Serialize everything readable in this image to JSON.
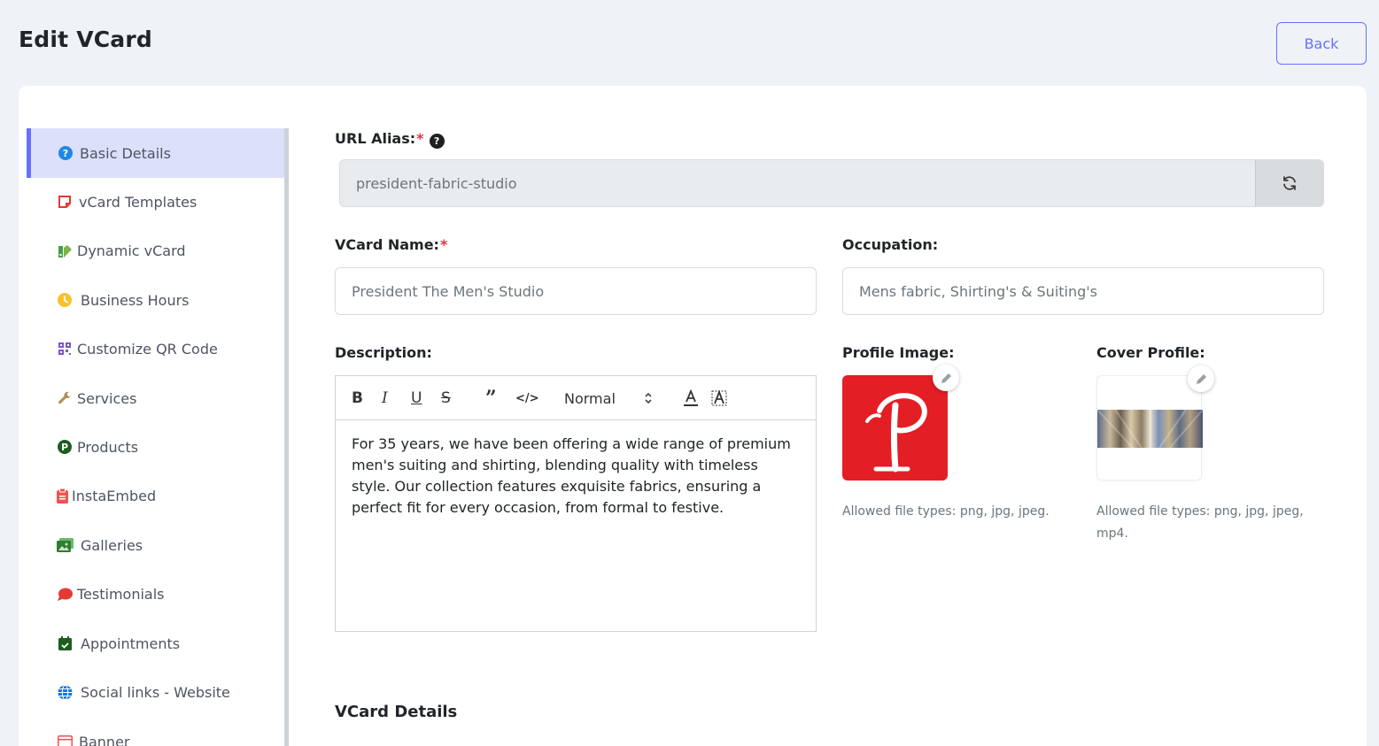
{
  "header": {
    "title": "Edit VCard",
    "back_label": "Back"
  },
  "sidebar": {
    "items": [
      {
        "label": "Basic Details",
        "icon": "question-circle-icon",
        "active": true
      },
      {
        "label": "vCard Templates",
        "icon": "template-icon"
      },
      {
        "label": "Dynamic vCard",
        "icon": "dynamic-palette-icon"
      },
      {
        "label": "Business Hours",
        "icon": "clock-icon"
      },
      {
        "label": "Customize QR Code",
        "icon": "qr-code-icon"
      },
      {
        "label": "Services",
        "icon": "wrench-icon"
      },
      {
        "label": "Products",
        "icon": "product-p-icon"
      },
      {
        "label": "InstaEmbed",
        "icon": "clipboard-icon"
      },
      {
        "label": "Galleries",
        "icon": "image-icon"
      },
      {
        "label": "Testimonials",
        "icon": "comment-icon"
      },
      {
        "label": "Appointments",
        "icon": "calendar-check-icon"
      },
      {
        "label": "Social links - Website",
        "icon": "globe-icon"
      },
      {
        "label": "Banner",
        "icon": "banner-icon"
      }
    ]
  },
  "form": {
    "url_alias": {
      "label": "URL Alias:",
      "required": "*",
      "value": "president-fabric-studio"
    },
    "vcard_name": {
      "label": "VCard Name:",
      "required": "*",
      "value": "President The Men's Studio"
    },
    "occupation": {
      "label": "Occupation:",
      "value": "Mens fabric, Shirting's & Suiting's"
    },
    "description": {
      "label": "Description:",
      "format_select": "Normal",
      "text": "For 35 years, we have been offering a wide range of premium men's suiting and shirting, blending quality with timeless style. Our collection features exquisite fabrics, ensuring a perfect fit for every occasion, from formal to festive."
    },
    "profile_image": {
      "label": "Profile Image:",
      "hint": "Allowed file types: png, jpg, jpeg."
    },
    "cover_profile": {
      "label": "Cover Profile:",
      "hint": "Allowed file types: png, jpg, jpeg, mp4."
    }
  },
  "sections": {
    "vcard_details": "VCard Details"
  },
  "colors": {
    "accent": "#6571ff",
    "required": "#e5343d",
    "profile_bg": "#e31e24"
  }
}
